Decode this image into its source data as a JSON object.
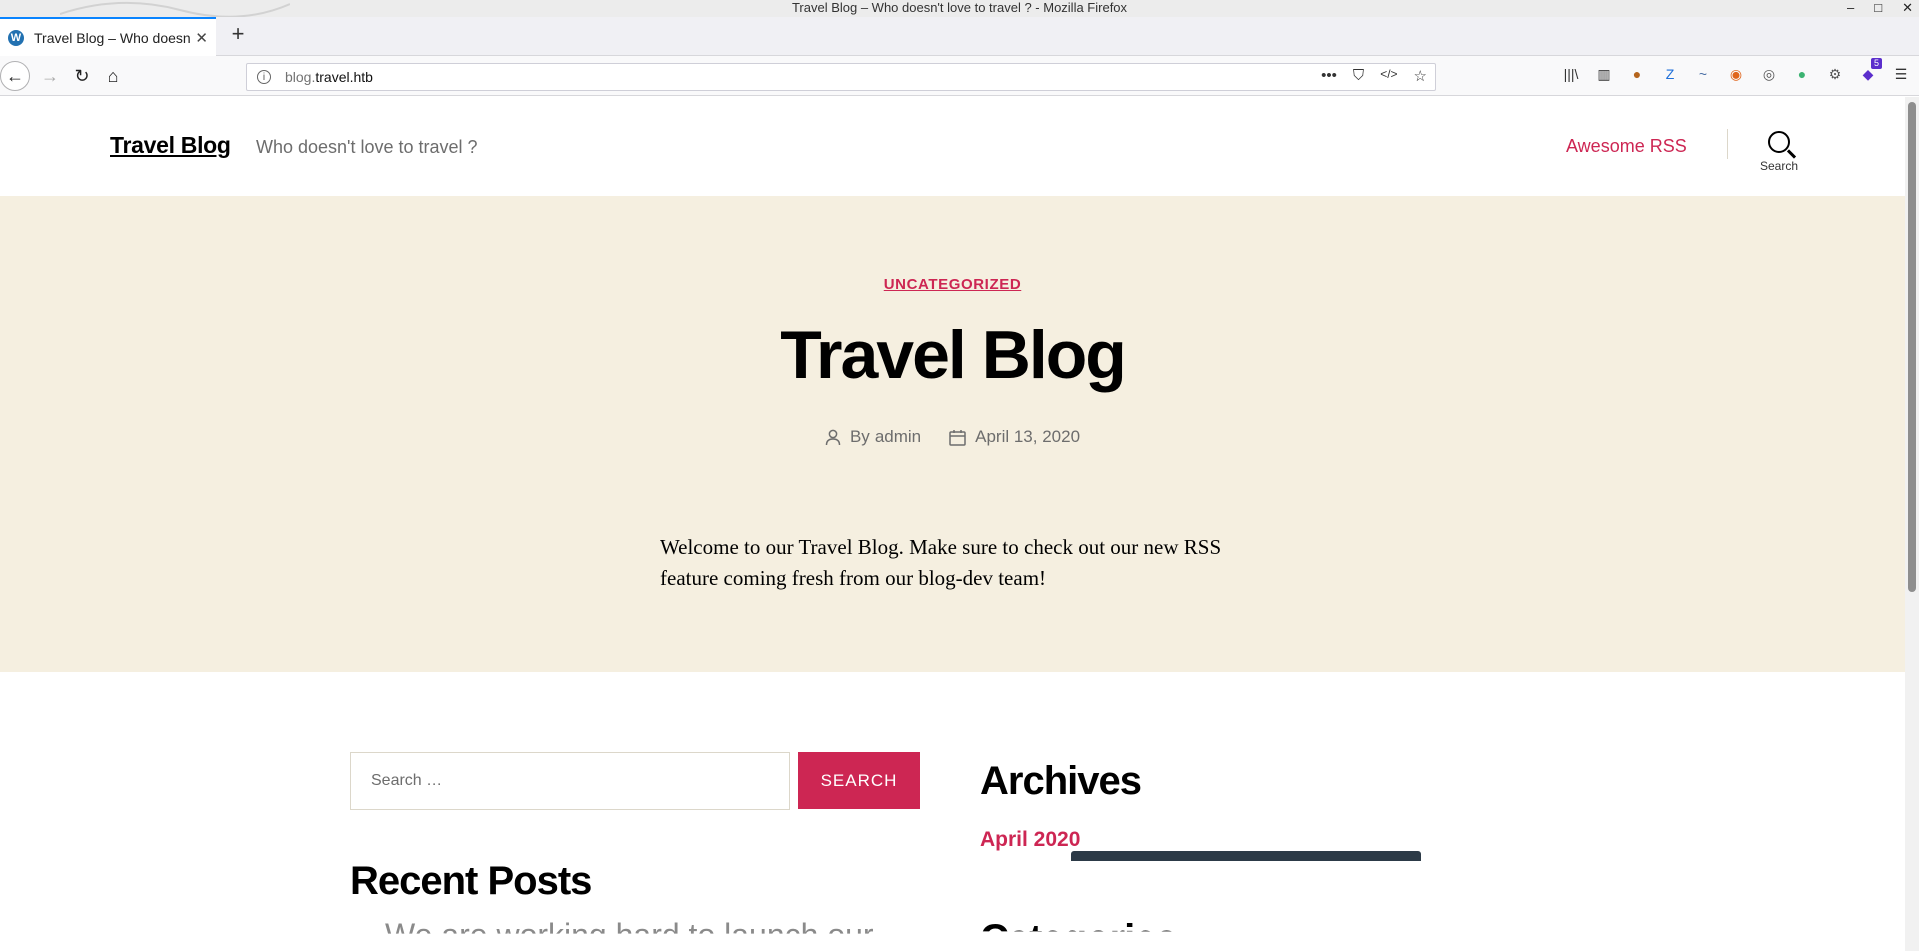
{
  "window": {
    "title": "Travel Blog – Who doesn't love to travel ? - Mozilla Firefox",
    "controls": [
      "–",
      "□",
      "✕"
    ]
  },
  "tabs": [
    {
      "label": "Travel Blog – Who doesn't love to travel ?",
      "favicon": "W",
      "close": "✕"
    }
  ],
  "new_tab_label": "+",
  "address_bar": {
    "url_prefix": "blog.",
    "url_domain": "travel.htb",
    "info_glyph": "i",
    "page_actions": [
      "•••",
      "⛉",
      "</>",
      "☆"
    ]
  },
  "nav_glyphs": {
    "back": "←",
    "forward": "→",
    "reload": "↻",
    "home": "⌂"
  },
  "toolbar_icons": [
    {
      "name": "library-icon",
      "glyph": "|||\\"
    },
    {
      "name": "sidebar-icon",
      "glyph": "▥"
    },
    {
      "name": "cookie-icon",
      "glyph": "●",
      "color": "#b5651d"
    },
    {
      "name": "zotero-icon",
      "glyph": "Z",
      "color": "#1e6fd9"
    },
    {
      "name": "wappalyzer-icon",
      "glyph": "~",
      "color": "#4a6fa5"
    },
    {
      "name": "basketball-icon",
      "glyph": "◉",
      "color": "#e0661d"
    },
    {
      "name": "user-icon",
      "glyph": "◎",
      "color": "#555"
    },
    {
      "name": "foxyproxy-icon",
      "glyph": "●",
      "color": "#3cb371"
    },
    {
      "name": "settings-icon",
      "glyph": "⚙",
      "color": "#555"
    },
    {
      "name": "extension-icon",
      "glyph": "◆",
      "color": "#5b2ecc",
      "badge": "5"
    },
    {
      "name": "menu-icon",
      "glyph": "☰",
      "color": "#333"
    }
  ],
  "site": {
    "title": "Travel Blog",
    "description": "Who doesn't love to travel ?",
    "nav_link": "Awesome RSS",
    "search_label": "Search"
  },
  "post": {
    "category": "UNCATEGORIZED",
    "title": "Travel Blog",
    "author_prefix": "By",
    "author": "admin",
    "date": "April 13, 2020",
    "body": "Welcome to our Travel Blog. Make sure to check out our new RSS feature coming fresh from our blog-dev team!"
  },
  "widgets": {
    "search_placeholder": "Search …",
    "search_button": "SEARCH",
    "recent_posts_heading": "Recent Posts",
    "recent_post_partial": "We are working hard to launch our",
    "archives_heading": "Archives",
    "archive_link": "April 2020",
    "categories_heading": "Categories"
  },
  "colors": {
    "accent": "#cd2653",
    "hero_bg": "#f5efe0",
    "firefox_blue": "#0a84ff"
  }
}
